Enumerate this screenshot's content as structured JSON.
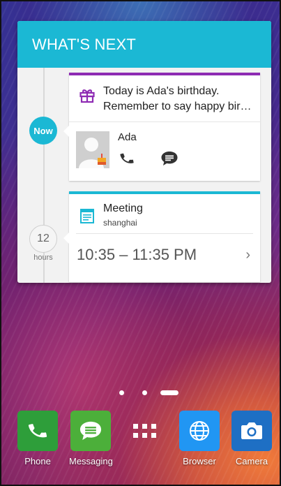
{
  "widget": {
    "title": "WHAT'S NEXT",
    "now_label": "Now",
    "hours_value": "12",
    "hours_label": "hours",
    "birthday": {
      "line1": "Today is Ada's birthday.",
      "line2": "Remember to say happy birt…",
      "contact_name": "Ada",
      "accent_color": "#8e2bb3",
      "icon": "gift-icon"
    },
    "meeting": {
      "title": "Meeting",
      "location": "shanghai",
      "time": "10:35 – 11:35 PM",
      "chevron": "›",
      "accent_color": "#1bb8d4",
      "icon": "calendar-icon"
    }
  },
  "page_indicator": {
    "pages": 3,
    "active_index": 2
  },
  "dock": [
    {
      "label": "Phone",
      "icon": "phone-icon",
      "color": "#2e9e3a"
    },
    {
      "label": "Messaging",
      "icon": "message-icon",
      "color": "#4caf3a"
    },
    {
      "label": "",
      "icon": "app-drawer-icon",
      "color": "transparent"
    },
    {
      "label": "Browser",
      "icon": "globe-icon",
      "color": "#2196f3"
    },
    {
      "label": "Camera",
      "icon": "camera-icon",
      "color": "#1e6fc4"
    }
  ]
}
